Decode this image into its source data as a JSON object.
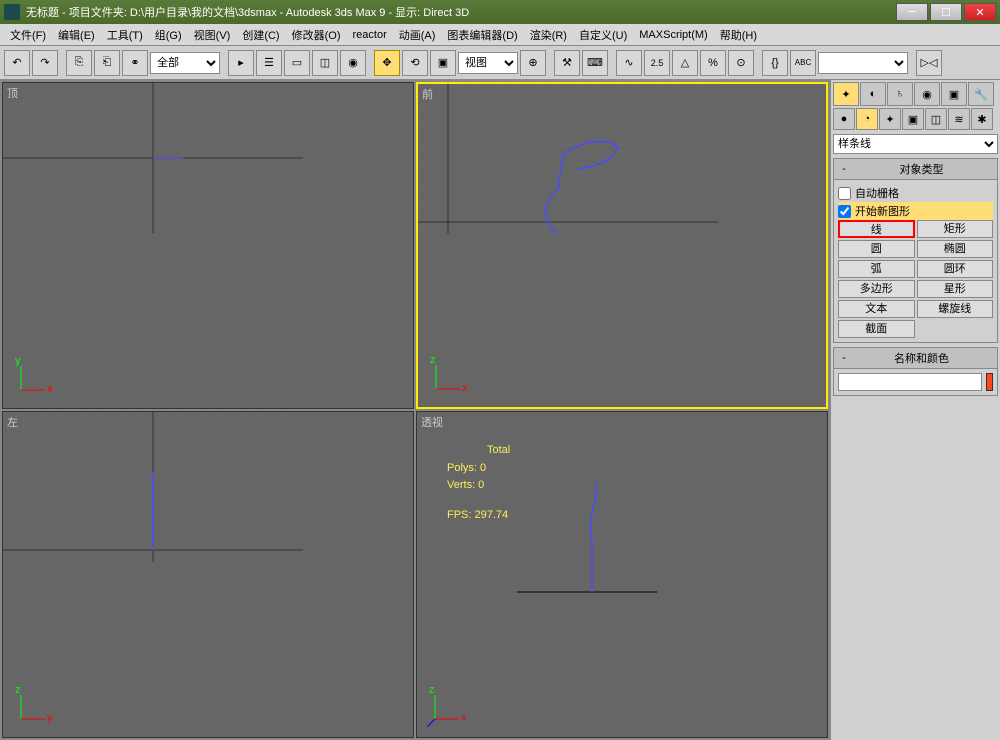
{
  "title": "无标题    - 项目文件夹: D:\\用户目录\\我的文档\\3dsmax        - Autodesk 3ds Max 9       - 显示: Direct 3D",
  "menus": [
    "文件(F)",
    "编辑(E)",
    "工具(T)",
    "组(G)",
    "视图(V)",
    "创建(C)",
    "修改器(O)",
    "reactor",
    "动画(A)",
    "图表编辑器(D)",
    "渲染(R)",
    "自定义(U)",
    "MAXScript(M)",
    "帮助(H)"
  ],
  "toolbar": {
    "scope": "全部",
    "coord": "视图"
  },
  "viewports": {
    "top": "顶",
    "front": "前",
    "left": "左",
    "persp": "透视"
  },
  "stats": {
    "header": "Total",
    "polys": "Polys: 0",
    "verts": "Verts: 0",
    "fps": "FPS:   297.74"
  },
  "panel": {
    "category": "样条线",
    "rollout1": "对象类型",
    "auto_grid": "自动栅格",
    "start_new": "开始新图形",
    "objects": [
      [
        "线",
        "矩形"
      ],
      [
        "圆",
        "椭圆"
      ],
      [
        "弧",
        "圆环"
      ],
      [
        "多边形",
        "星形"
      ],
      [
        "文本",
        "螺旋线"
      ],
      [
        "截面",
        ""
      ]
    ],
    "rollout2": "名称和颜色"
  }
}
